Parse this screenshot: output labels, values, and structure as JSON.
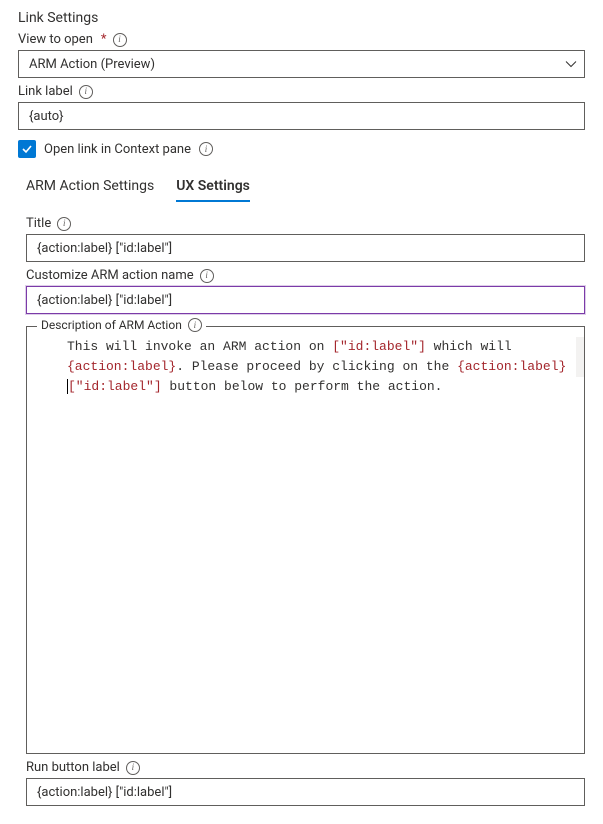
{
  "heading": "Link Settings",
  "fields": {
    "view_to_open": {
      "label": "View to open",
      "value": "ARM Action (Preview)"
    },
    "link_label": {
      "label": "Link label",
      "value": "{auto}"
    },
    "open_context": {
      "label": "Open link in Context pane",
      "checked": true
    }
  },
  "tabs": {
    "arm": "ARM Action Settings",
    "ux": "UX Settings"
  },
  "ux": {
    "title": {
      "label": "Title",
      "value": "{action:label} [\"id:label\"]"
    },
    "customize_name": {
      "label": "Customize ARM action name",
      "value": "{action:label} [\"id:label\"]"
    },
    "description": {
      "label": "Description of ARM Action",
      "text_plain_1": "This will invoke an ARM action on ",
      "text_red_1": "[\"id:label\"]",
      "text_plain_2": " which will ",
      "text_red_2": "{action:label}",
      "text_plain_3": ". Please proceed by clicking on the ",
      "text_red_3": "{action:label} ",
      "text_red_4": "[\"id:label\"]",
      "text_plain_4": " button below to perform the action."
    },
    "run_button": {
      "label": "Run button label",
      "value": "{action:label} [\"id:label\"]"
    }
  }
}
